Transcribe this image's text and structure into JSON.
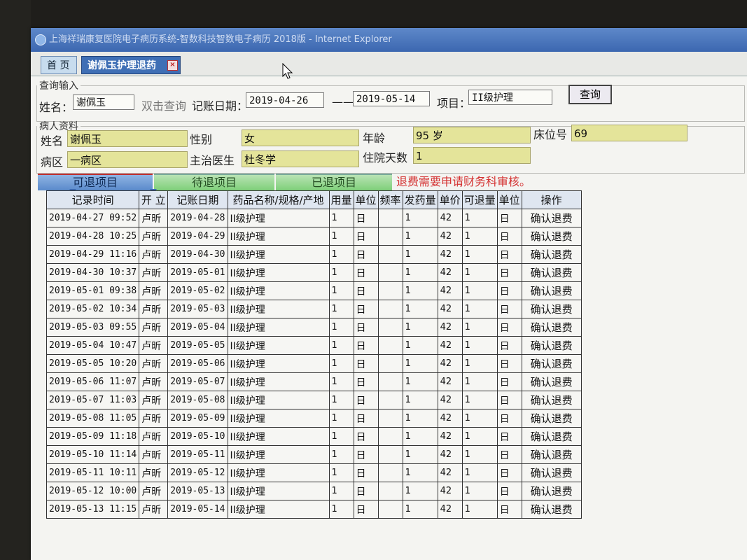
{
  "window": {
    "title": "上海祥瑞康复医院电子病历系统-智数科技智数电子病历 2018版 - Internet Explorer"
  },
  "tabs": {
    "home": "首 页",
    "active": "谢佩玉护理退药",
    "close_symbol": "×"
  },
  "query": {
    "legend": "查询输入",
    "name_label": "姓名：",
    "name_value": "谢佩玉",
    "dbl_click_hint": "双击查询",
    "date_label": "记账日期：",
    "date_from": "2019-04-26",
    "date_sep": "——",
    "date_to": "2019-05-14",
    "item_label": "项目：",
    "item_value": "II级护理",
    "search_button": "查询"
  },
  "patient": {
    "legend": "病人资料",
    "name_label": "姓名",
    "name_value": "谢佩玉",
    "gender_label": "性别",
    "gender_value": "女",
    "age_label": "年龄",
    "age_value": "95 岁",
    "bed_label": "床位号",
    "bed_value": "69",
    "ward_label": "病区",
    "ward_value": "一病区",
    "doctor_label": "主治医生",
    "doctor_value": "杜冬学",
    "days_label": "住院天数",
    "days_value": "1"
  },
  "subtabs": {
    "refundable": "可退项目",
    "pending": "待退项目",
    "refunded": "已退项目"
  },
  "warning": "退费需要申请财务科审核。",
  "table": {
    "headers": [
      "记录时间",
      "开 立",
      "记账日期",
      "药品名称/规格/产地",
      "用量",
      "单位",
      "频率",
      "发药量",
      "单价",
      "可退量",
      "单位",
      "操作"
    ],
    "rows": [
      [
        "2019-04-27 09:52",
        "卢昕",
        "2019-04-28",
        "II级护理",
        "1",
        "日",
        "",
        "1",
        "42",
        "1",
        "日",
        "确认退费"
      ],
      [
        "2019-04-28 10:25",
        "卢昕",
        "2019-04-29",
        "II级护理",
        "1",
        "日",
        "",
        "1",
        "42",
        "1",
        "日",
        "确认退费"
      ],
      [
        "2019-04-29 11:16",
        "卢昕",
        "2019-04-30",
        "II级护理",
        "1",
        "日",
        "",
        "1",
        "42",
        "1",
        "日",
        "确认退费"
      ],
      [
        "2019-04-30 10:37",
        "卢昕",
        "2019-05-01",
        "II级护理",
        "1",
        "日",
        "",
        "1",
        "42",
        "1",
        "日",
        "确认退费"
      ],
      [
        "2019-05-01 09:38",
        "卢昕",
        "2019-05-02",
        "II级护理",
        "1",
        "日",
        "",
        "1",
        "42",
        "1",
        "日",
        "确认退费"
      ],
      [
        "2019-05-02 10:34",
        "卢昕",
        "2019-05-03",
        "II级护理",
        "1",
        "日",
        "",
        "1",
        "42",
        "1",
        "日",
        "确认退费"
      ],
      [
        "2019-05-03 09:55",
        "卢昕",
        "2019-05-04",
        "II级护理",
        "1",
        "日",
        "",
        "1",
        "42",
        "1",
        "日",
        "确认退费"
      ],
      [
        "2019-05-04 10:47",
        "卢昕",
        "2019-05-05",
        "II级护理",
        "1",
        "日",
        "",
        "1",
        "42",
        "1",
        "日",
        "确认退费"
      ],
      [
        "2019-05-05 10:20",
        "卢昕",
        "2019-05-06",
        "II级护理",
        "1",
        "日",
        "",
        "1",
        "42",
        "1",
        "日",
        "确认退费"
      ],
      [
        "2019-05-06 11:07",
        "卢昕",
        "2019-05-07",
        "II级护理",
        "1",
        "日",
        "",
        "1",
        "42",
        "1",
        "日",
        "确认退费"
      ],
      [
        "2019-05-07 11:03",
        "卢昕",
        "2019-05-08",
        "II级护理",
        "1",
        "日",
        "",
        "1",
        "42",
        "1",
        "日",
        "确认退费"
      ],
      [
        "2019-05-08 11:05",
        "卢昕",
        "2019-05-09",
        "II级护理",
        "1",
        "日",
        "",
        "1",
        "42",
        "1",
        "日",
        "确认退费"
      ],
      [
        "2019-05-09 11:18",
        "卢昕",
        "2019-05-10",
        "II级护理",
        "1",
        "日",
        "",
        "1",
        "42",
        "1",
        "日",
        "确认退费"
      ],
      [
        "2019-05-10 11:14",
        "卢昕",
        "2019-05-11",
        "II级护理",
        "1",
        "日",
        "",
        "1",
        "42",
        "1",
        "日",
        "确认退费"
      ],
      [
        "2019-05-11 10:11",
        "卢昕",
        "2019-05-12",
        "II级护理",
        "1",
        "日",
        "",
        "1",
        "42",
        "1",
        "日",
        "确认退费"
      ],
      [
        "2019-05-12 10:00",
        "卢昕",
        "2019-05-13",
        "II级护理",
        "1",
        "日",
        "",
        "1",
        "42",
        "1",
        "日",
        "确认退费"
      ],
      [
        "2019-05-13 11:15",
        "卢昕",
        "2019-05-14",
        "II级护理",
        "1",
        "日",
        "",
        "1",
        "42",
        "1",
        "日",
        "确认退费"
      ]
    ]
  }
}
